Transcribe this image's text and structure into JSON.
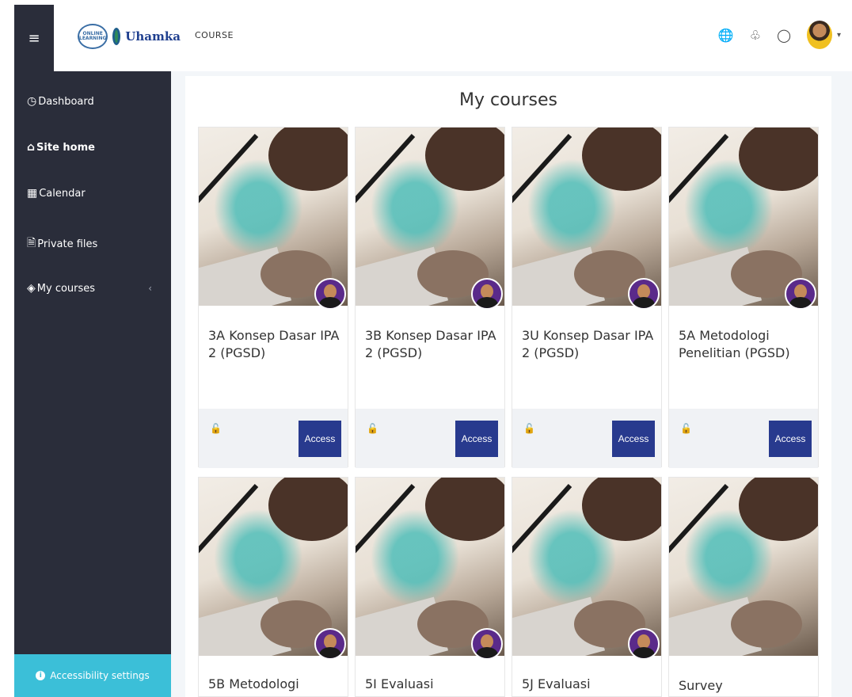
{
  "header": {
    "logo_small": "ONLINE LEARNING",
    "logo_brand": "Uhamka",
    "nav_course": "COURSE",
    "icons": [
      "menu-icon",
      "globe-icon",
      "bell-icon",
      "chat-icon",
      "avatar"
    ]
  },
  "sidebar": {
    "items": [
      {
        "label": "Dashboard",
        "icon": "dashboard-icon"
      },
      {
        "label": "Site home",
        "icon": "home-icon"
      },
      {
        "label": "Calendar",
        "icon": "calendar-icon"
      },
      {
        "label": "Private files",
        "icon": "file-icon"
      },
      {
        "label": "My courses",
        "icon": "graduation-icon"
      }
    ],
    "accessibility": "Accessibility settings"
  },
  "main": {
    "title": "My courses",
    "access_label": "Access",
    "courses": [
      {
        "title": "3A Konsep Dasar IPA 2 (PGSD)"
      },
      {
        "title": "3B Konsep Dasar IPA 2 (PGSD)"
      },
      {
        "title": "3U Konsep Dasar IPA 2 (PGSD)"
      },
      {
        "title": "5A Metodologi Penelitian (PGSD)"
      },
      {
        "title": "5B Metodologi"
      },
      {
        "title": "5I Evaluasi"
      },
      {
        "title": "5J Evaluasi"
      },
      {
        "title": "Survey"
      }
    ]
  },
  "colors": {
    "sidebar": "#2a2d3a",
    "accessibility_bar": "#3bbfd8",
    "access_button": "#283a8e"
  }
}
